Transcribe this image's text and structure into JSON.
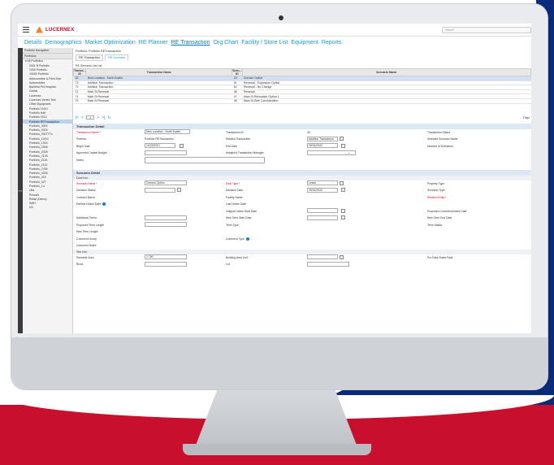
{
  "app": {
    "logo": "LUCERNEX",
    "search_placeholder": "Search"
  },
  "nav": [
    "Details",
    "Demographics",
    "Market Optimization",
    "RE Planner",
    "RE Transaction",
    "Org Chart",
    "Facility / Store List",
    "Equipment",
    "Reports"
  ],
  "nav_active": "RE Transaction",
  "sidebar": {
    "title": "Portfolio Navigation",
    "subtitle": "Portfolios",
    "items": [
      "All Portfolios",
      "2001 B Portfolio",
      "1000 Portfolio",
      "10000 Portfolio",
      "Abercrombie & Fitch Rob",
      "Automobiles",
      "Banfield Pet Hospital",
      "Global",
      "Lucernex",
      "Lucernex Vertex Test",
      "Other Equipment",
      "Portfolio 10/10",
      "Portfolio Half",
      "Portfolio 2012",
      "Portfolio RETransaction",
      "Portfolio_0002",
      "Portfolio_0003",
      "Portfolio_0007TTx",
      "Portfolio_10/10",
      "Portfolio_1916",
      "Portfolio_2006",
      "Portfolio_2008",
      "Portfolio_2108",
      "Portfolio_2115",
      "Portfolio_2112",
      "Portfolio_2765",
      "Portfolio_3036",
      "Portfolio_315",
      "Portfolio_327",
      "Portfolio_Lu",
      "Ulta",
      "Primark",
      "Retail (Demo)",
      "SMH",
      "US"
    ],
    "selected": "Portfolio RETransaction",
    "collapse_label": ">>"
  },
  "breadcrumb": "Portfolio: Portfolio RETransaction",
  "subtabs": [
    "RE Transaction",
    "RE Scenario"
  ],
  "subtab_active": "RE Scenario",
  "list": {
    "caption": "RE Scenario List List",
    "headers": {
      "trans_id": "Transa... ID",
      "trans_name": "Transaction Name",
      "scen_id": "Scen... ID",
      "scen_name": "Scenario Name"
    },
    "rows": [
      {
        "trans_id": "32",
        "trans_name": "New Location - North Austin",
        "scen_id": "29",
        "scen_name": "Domain Option",
        "selected": true
      },
      {
        "trans_id": "73",
        "trans_name": "Addition Transaction",
        "scen_id": "51",
        "scen_name": "Renewal - Expansion Option"
      },
      {
        "trans_id": "73",
        "trans_name": "Addition Transaction",
        "scen_id": "52",
        "scen_name": "Renewal - No Change"
      },
      {
        "trans_id": "74",
        "trans_name": "Main St Renewal",
        "scen_id": "48",
        "scen_name": "Renewal"
      },
      {
        "trans_id": "74",
        "trans_name": "Main St Renewal",
        "scen_id": "47",
        "scen_name": "Main St Relocation Option 1"
      },
      {
        "trans_id": "75",
        "trans_name": "Main St Renewal",
        "scen_id": "48",
        "scen_name": "Main St Sale Consideration"
      }
    ]
  },
  "pager": {
    "page": "1",
    "display": "Displ"
  },
  "transaction_detail": {
    "title": "Transaction Detail",
    "transaction_name_label": "Transaction Name *",
    "transaction_name_value": "New Location - North Austin",
    "transaction_id_label": "Transaction ID",
    "transaction_id_value": "32",
    "transaction_status_label": "Transaction Status",
    "portfolio_label": "Portfolio",
    "portfolio_value": "Portfolio RETransaction",
    "related_transaction_label": "Related Transaction",
    "related_transaction_value": "Addition Transaction",
    "selected_scenario_label": "Selected Scenario Name",
    "begin_date_label": "Begin Date",
    "begin_date_value": "10/29/2021",
    "end_date_label": "End Date",
    "end_date_value": "05/31/2022",
    "number_scenarios_label": "Number of Scenarios",
    "approved_budget_label": "Approved Capital Budget",
    "assigned_manager_label": "Assigned Transaction Manager",
    "notes_label": "Notes"
  },
  "scenario_detail": {
    "title": "Scenario Detail",
    "deal_info": "Deal Info",
    "scenario_name_label": "Scenario Name *",
    "scenario_name_value": "Domain Option",
    "deal_type_label": "Deal Type *",
    "deal_type_value": "Lease",
    "property_type_label": "Property Type",
    "decision_status_label": "Decision Status",
    "decision_date_label": "Decision Date",
    "decision_date_value": "05/31/2022",
    "scenario_type_label": "Scenario Type",
    "contract_name_label": "Contract Name",
    "facility_name_label": "Facility Name",
    "related_entity_label": "Related Entity *",
    "earliest_notice_label": "Earliest Notice Date",
    "last_notice_label": "Last Notice Date",
    "original_lease_start_label": "Original Lease Start Date",
    "proposed_commencement_label": "Proposed Commencement Date",
    "additional_terms_label": "Additional Terms",
    "new_term_start_label": "New Term Start Date",
    "new_term_end_label": "New Term End Date",
    "proposed_term_length_label": "Proposed Term Length",
    "term_type_label": "Term Type",
    "term_status_label": "Term Status",
    "new_term_length_label": "New Term Length",
    "comment_group_label": "Comment Group",
    "comment_type_label": "Comment Type",
    "comment_notes_label": "Comment Notes",
    "site_info": "Site Info",
    "rentable_area_label": "Rentable Area",
    "rentable_area_value": "2,780",
    "building_area_unit_label": "Building Area Unit",
    "pro_rata_label": "Pro Rata Share Rate",
    "block_label": "Block",
    "lot_label": "Lot"
  }
}
